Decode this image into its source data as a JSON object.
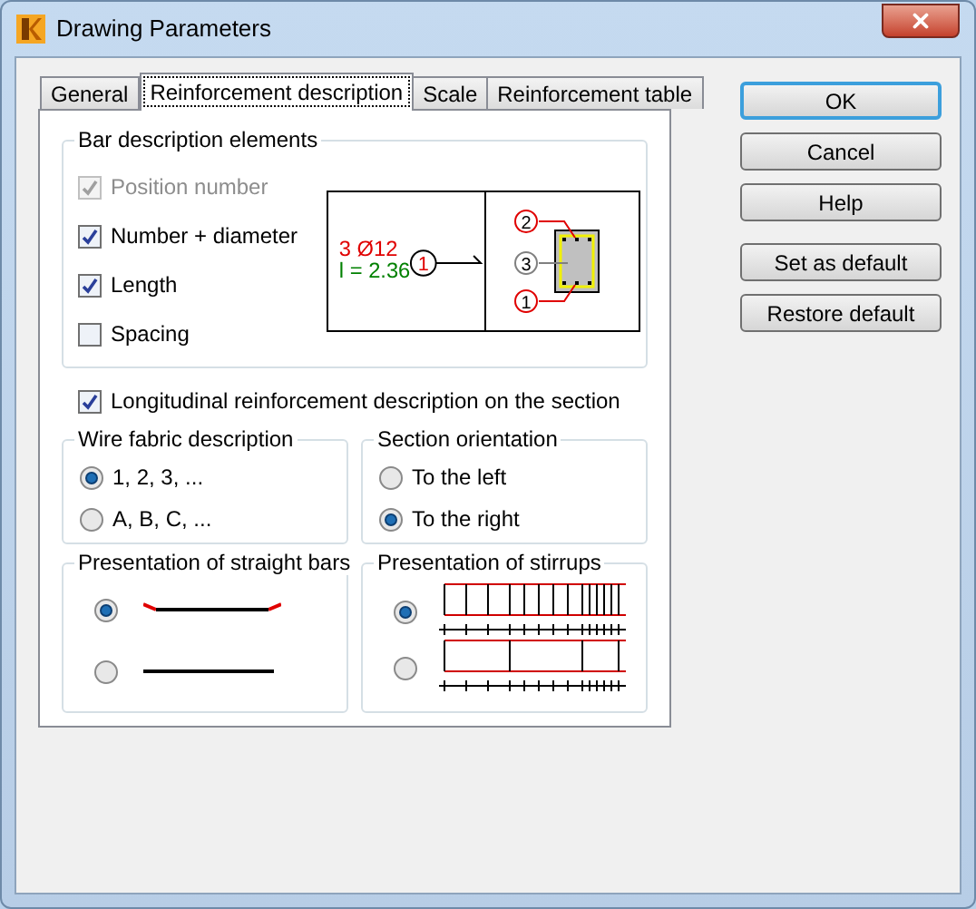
{
  "window": {
    "title": "Drawing Parameters"
  },
  "tabs": [
    {
      "label": "General",
      "selected": false
    },
    {
      "label": "Reinforcement description",
      "selected": true
    },
    {
      "label": "Scale",
      "selected": false
    },
    {
      "label": "Reinforcement table",
      "selected": false
    }
  ],
  "bar_description": {
    "title": "Bar description elements",
    "options": [
      {
        "label": "Position number",
        "checked": true,
        "disabled": true
      },
      {
        "label": "Number + diameter",
        "checked": true,
        "disabled": false
      },
      {
        "label": "Length",
        "checked": true,
        "disabled": false
      },
      {
        "label": "Spacing",
        "checked": false,
        "disabled": false
      }
    ],
    "diagram": {
      "quantity_diameter": "3 Ø12",
      "length": "l = 2.36",
      "marks": [
        "1",
        "2",
        "3",
        "1"
      ]
    }
  },
  "longitudinal": {
    "label": "Longitudinal reinforcement description on the section",
    "checked": true
  },
  "wire_fabric": {
    "title": "Wire fabric description",
    "options": [
      {
        "label": "1, 2, 3, ...",
        "selected": true
      },
      {
        "label": "A, B, C, ...",
        "selected": false
      }
    ]
  },
  "section_orientation": {
    "title": "Section orientation",
    "options": [
      {
        "label": "To the left",
        "selected": false
      },
      {
        "label": "To the right",
        "selected": true
      }
    ]
  },
  "straight_bars": {
    "title": "Presentation of straight bars",
    "options": [
      {
        "kind": "hooked",
        "selected": true
      },
      {
        "kind": "plain",
        "selected": false
      }
    ]
  },
  "stirrups": {
    "title": "Presentation of stirrups",
    "options": [
      {
        "kind": "dense",
        "selected": true
      },
      {
        "kind": "sparse",
        "selected": false
      }
    ]
  },
  "buttons": [
    {
      "label": "OK",
      "default": true
    },
    {
      "label": "Cancel",
      "default": false
    },
    {
      "label": "Help",
      "default": false
    },
    {
      "label": "Set as default",
      "default": false
    },
    {
      "label": "Restore default",
      "default": false
    }
  ]
}
